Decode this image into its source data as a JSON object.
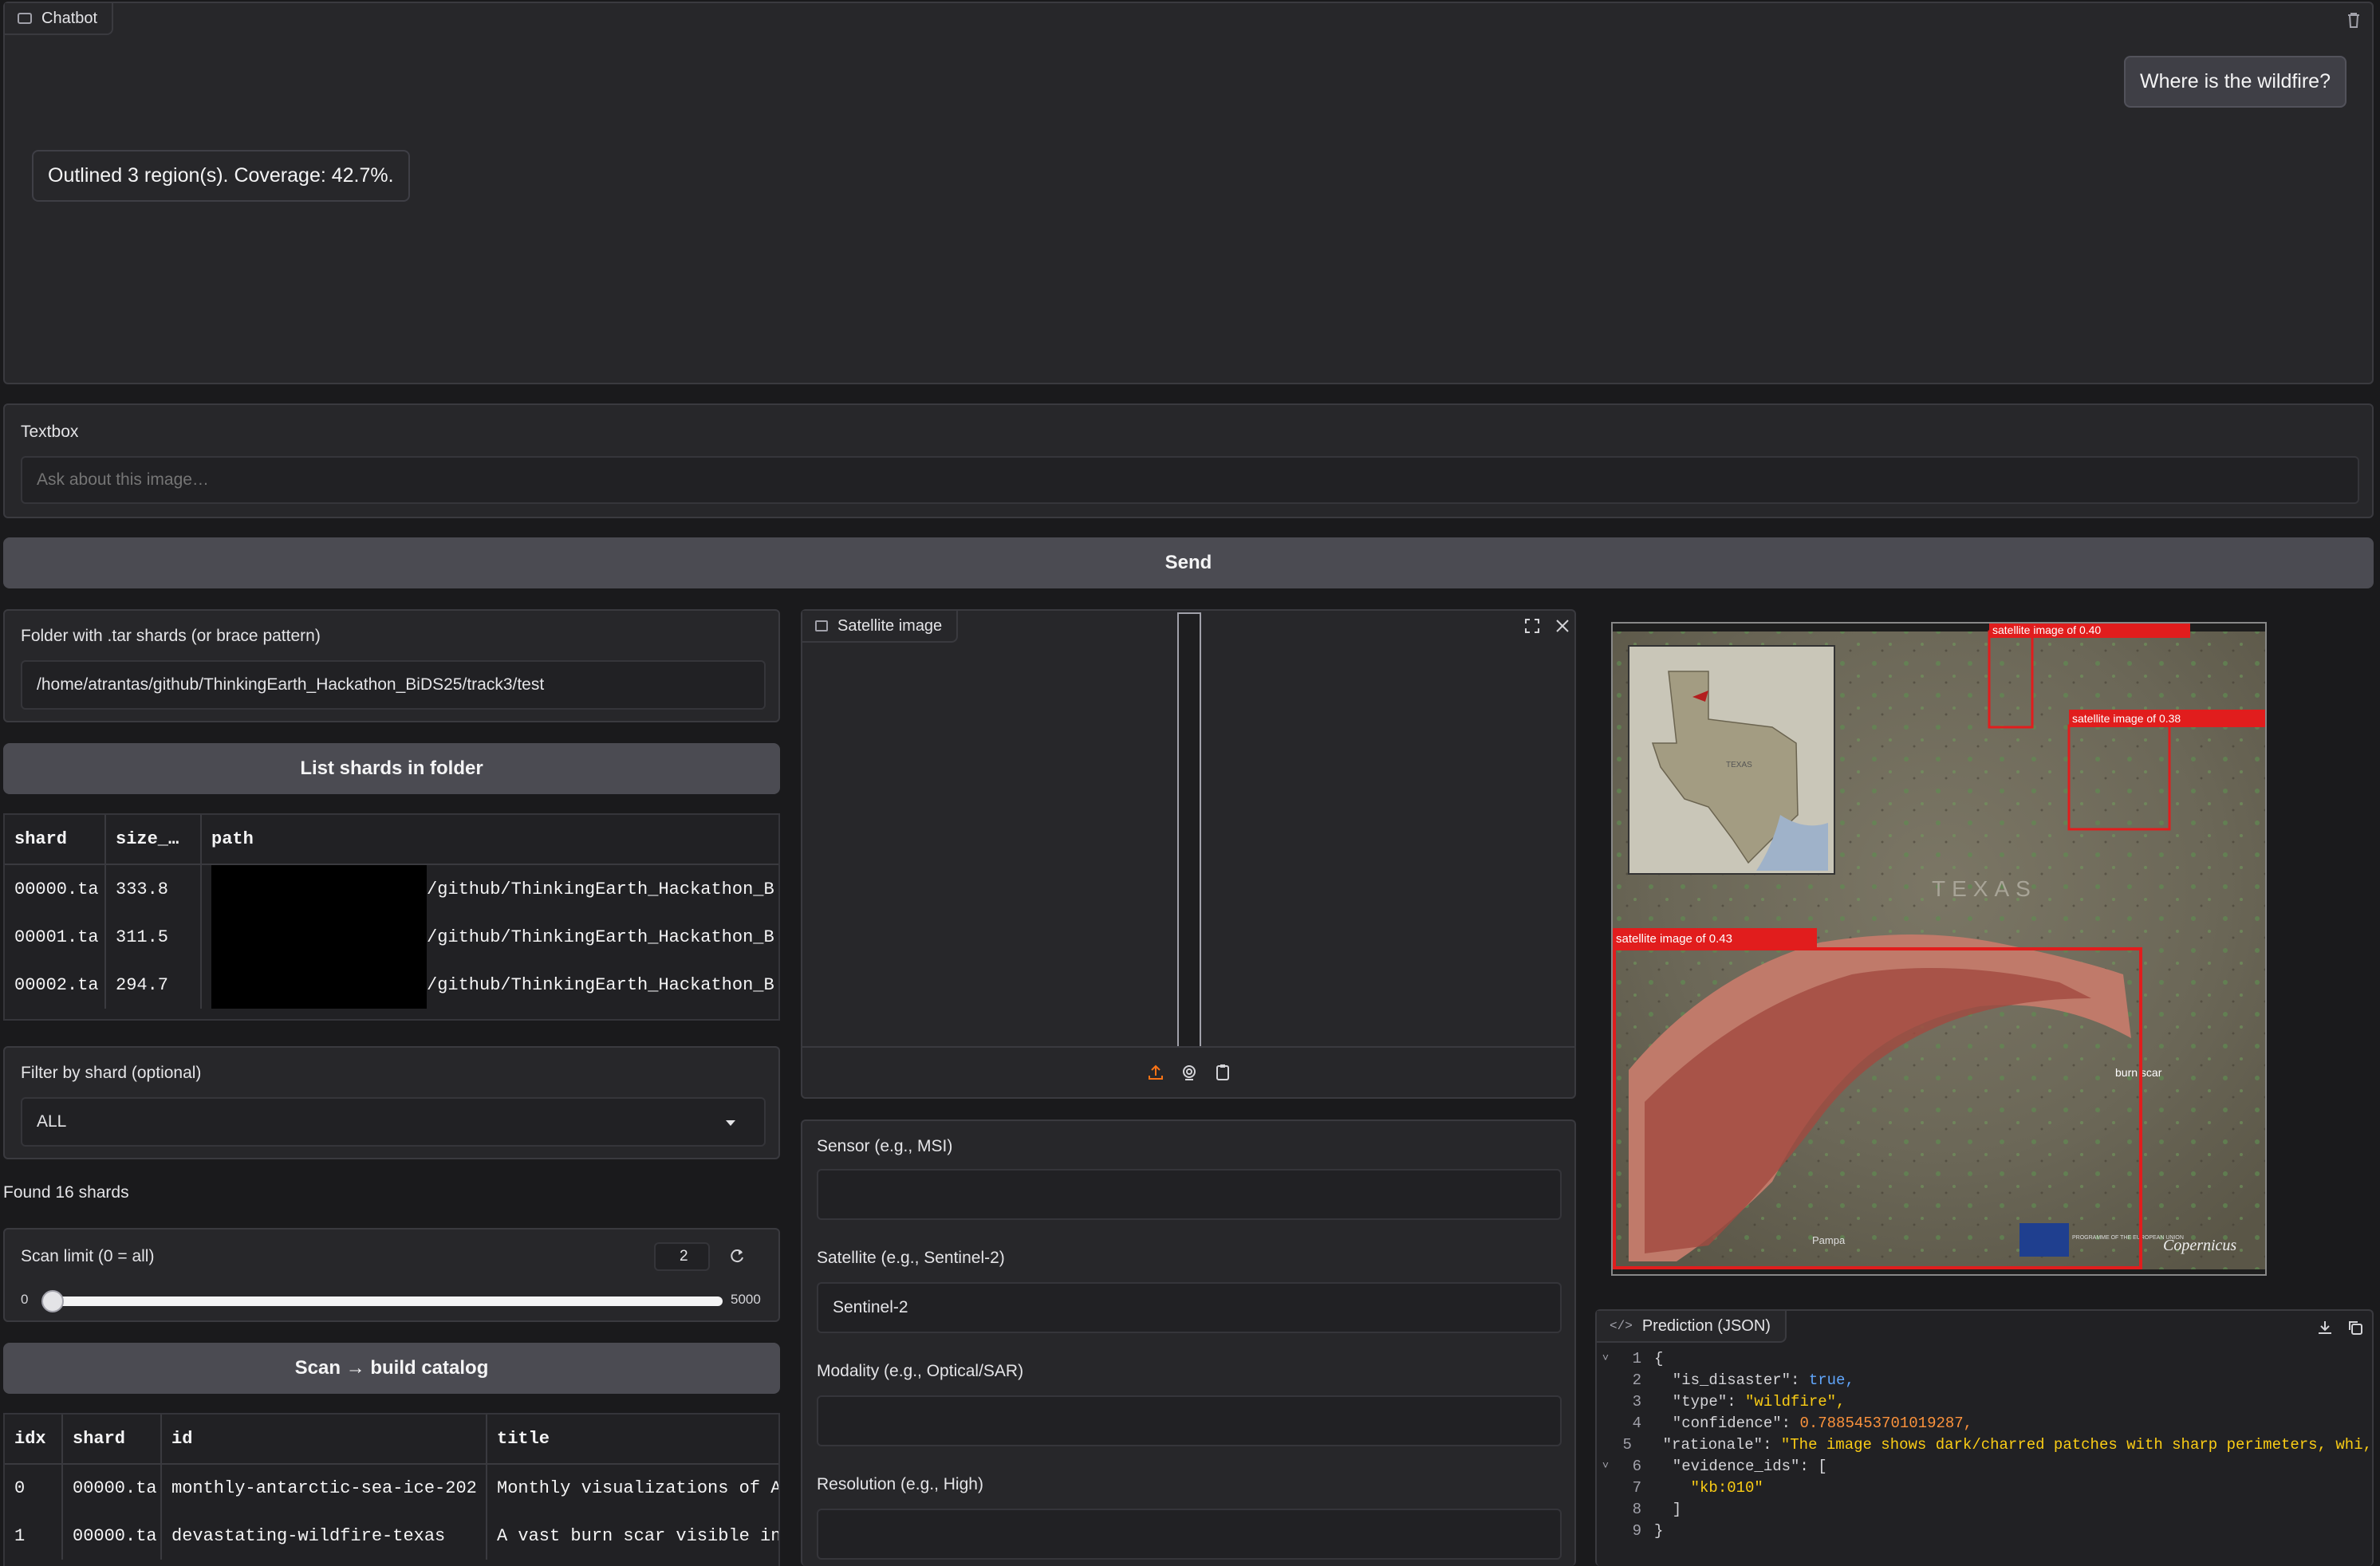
{
  "chatbot": {
    "label": "Chatbot",
    "user_message": "Where is the wildfire?",
    "bot_message": "Outlined 3 region(s). Coverage: 42.7%."
  },
  "textbox": {
    "label": "Textbox",
    "placeholder": "Ask about this image…",
    "value": ""
  },
  "send_button": "Send",
  "folder": {
    "label": "Folder with .tar shards (or brace pattern)",
    "value": "/home/atrantas/github/ThinkingEarth_Hackathon_BiDS25/track3/test"
  },
  "list_shards_button": "List shards in folder",
  "shard_table": {
    "headers": [
      "shard",
      "size_…",
      "path"
    ],
    "rows": [
      [
        "00000.ta",
        "333.8",
        "/github/ThinkingEarth_Hackathon_B"
      ],
      [
        "00001.ta",
        "311.5",
        "/github/ThinkingEarth_Hackathon_B"
      ],
      [
        "00002.ta",
        "294.7",
        "/github/ThinkingEarth_Hackathon_B"
      ]
    ]
  },
  "filter": {
    "label": "Filter by shard (optional)",
    "selected": "ALL"
  },
  "found_text": "Found 16 shards",
  "scan_limit": {
    "label": "Scan limit (0 = all)",
    "value": "2",
    "min": "0",
    "max": "5000",
    "fraction": 0.0004
  },
  "scan_button": "Scan → build catalog",
  "catalog_table": {
    "headers": [
      "idx",
      "shard",
      "id",
      "title"
    ],
    "rows": [
      [
        "0",
        "00000.ta",
        "monthly-antarctic-sea-ice-202",
        "Monthly visualizations of A"
      ],
      [
        "1",
        "00000.ta",
        "devastating-wildfire-texas",
        "A vast burn scar visible in"
      ]
    ]
  },
  "satellite_image": {
    "label": "Satellite image"
  },
  "sensor": {
    "label": "Sensor (e.g., MSI)",
    "value": ""
  },
  "satellite": {
    "label": "Satellite (e.g., Sentinel-2)",
    "value": "Sentinel-2"
  },
  "modality": {
    "label": "Modality (e.g., Optical/SAR)",
    "value": ""
  },
  "resolution": {
    "label": "Resolution (e.g., High)",
    "value": ""
  },
  "annotated_image": {
    "boxes": [
      {
        "label": "satellite image of 0.40"
      },
      {
        "label": "satellite image of 0.38"
      },
      {
        "label": "satellite image of 0.43"
      }
    ],
    "map_text": "TEXAS",
    "inset_label": "TEXAS",
    "burn_scar_label": "burn scar",
    "pampa_label": "Pampa",
    "copernicus_label": "Copernicus",
    "programme_label": "PROGRAMME OF THE EUROPEAN UNION"
  },
  "prediction": {
    "label": "Prediction (JSON)",
    "lines": [
      {
        "n": "1",
        "text": "{"
      },
      {
        "n": "2",
        "key": "\"is_disaster\"",
        "val": "true",
        "kind": "bool"
      },
      {
        "n": "3",
        "key": "\"type\"",
        "val": "\"wildfire\"",
        "kind": "str"
      },
      {
        "n": "4",
        "key": "\"confidence\"",
        "val": "0.7885453701019287",
        "kind": "num"
      },
      {
        "n": "5",
        "key": "\"rationale\"",
        "val": "\"The image shows dark/charred patches with sharp perimeters, whi",
        "kind": "str"
      },
      {
        "n": "6",
        "key": "\"evidence_ids\"",
        "val": "[",
        "kind": "punct"
      },
      {
        "n": "7",
        "text": "    \"kb:010\""
      },
      {
        "n": "8",
        "text": "  ]"
      },
      {
        "n": "9",
        "text": "}"
      }
    ]
  },
  "colors": {
    "background": "#1a1a1c",
    "panel": "#27272a",
    "button": "#4b4b52",
    "accent": "#f97316",
    "box_red": "#e11d1d"
  }
}
